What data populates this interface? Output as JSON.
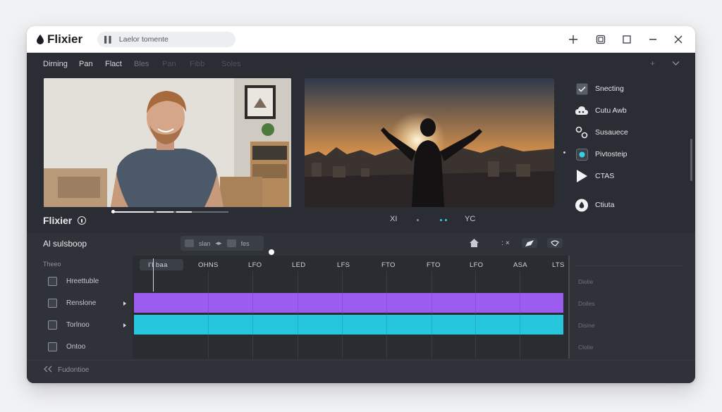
{
  "app": {
    "title": "Flixier",
    "search_placeholder": "Laelor tomente"
  },
  "menu": {
    "items": [
      "Dirning",
      "Pan",
      "Flact",
      "Bles",
      "Pan",
      "Fibb",
      "Soles"
    ],
    "right_icons": [
      "plus-icon",
      "chevron-down-icon"
    ]
  },
  "sidebar": {
    "items": [
      {
        "label": "Snecting",
        "icon": "checkbox-icon"
      },
      {
        "label": "Cutu Awb",
        "icon": "cloud-icon"
      },
      {
        "label": "Susauece",
        "icon": "nodes-icon"
      },
      {
        "label": "Pivtosteip",
        "icon": "target-icon"
      },
      {
        "label": "CTAS",
        "icon": "play-icon"
      },
      {
        "label": "Ctiuta",
        "icon": "drop-icon"
      }
    ]
  },
  "preview": {
    "label": "Flixier",
    "playback": {
      "left": "XI",
      "right": "YC"
    },
    "scrub_progress": 0.0
  },
  "ai_panel": {
    "label": "Al sulsboop",
    "toolbar": {
      "item1": "slan",
      "item2": "fes"
    },
    "right_tools": [
      "home-icon",
      ": ×",
      "edit-icon",
      "tag-icon"
    ]
  },
  "timeline": {
    "header": "Theeo",
    "ruler": [
      "I'I baa",
      "OHNS",
      "LFO",
      "LED",
      "LFS",
      "FTO",
      "FTO",
      "LFO",
      "ASA",
      "LTS"
    ],
    "tracks": [
      {
        "label": "Hreettuble",
        "icon": "grid-icon"
      },
      {
        "label": "Renslone",
        "icon": "camera-icon"
      },
      {
        "label": "Torlnoo",
        "icon": "image-icon"
      },
      {
        "label": "Ontoo",
        "icon": "film-icon"
      }
    ],
    "right_labels": [
      "Diolie",
      "Doiles",
      "Disine",
      "Clolie"
    ],
    "colors": {
      "video_clip": "#9d5cf0",
      "audio_clip": "#25c6de"
    }
  },
  "footer": {
    "label": "Fudontioe"
  }
}
